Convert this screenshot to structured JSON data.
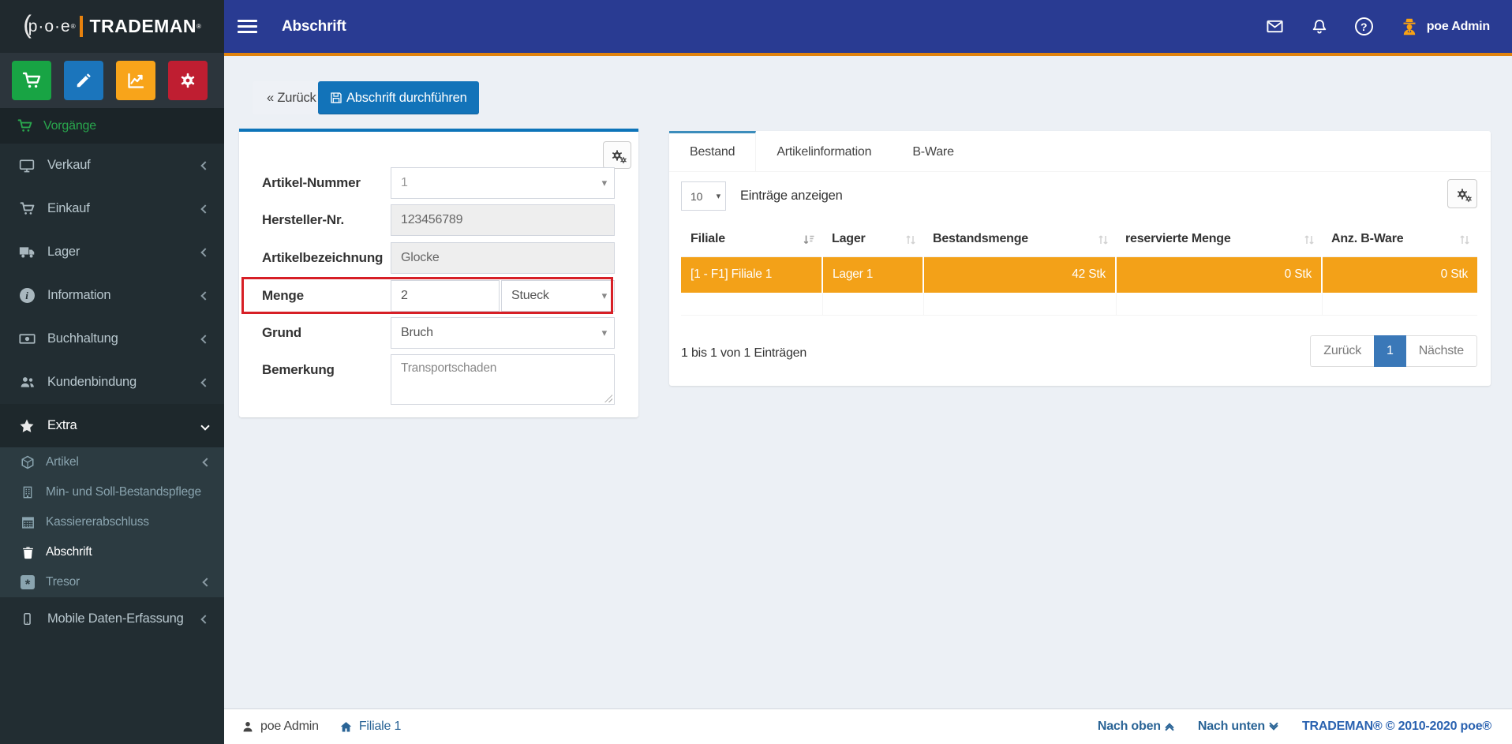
{
  "brand": {
    "arc": "(",
    "prefix": "p·o·e",
    "reg": "®",
    "name": "TRADEMAN"
  },
  "topbar": {
    "title": "Abschrift",
    "user": "poe Admin"
  },
  "sidebar": {
    "shortcuts": [
      {
        "icon": "cart-icon",
        "color": "#18a444"
      },
      {
        "icon": "pencil-icon",
        "color": "#1b75bc"
      },
      {
        "icon": "chart-icon",
        "color": "#f8a41a"
      },
      {
        "icon": "cogs-icon",
        "color": "#bf1e31"
      }
    ],
    "section_label": "Vorgänge",
    "items": [
      {
        "label": "Verkauf",
        "icon": "monitor-icon"
      },
      {
        "label": "Einkauf",
        "icon": "cart-icon"
      },
      {
        "label": "Lager",
        "icon": "truck-icon"
      },
      {
        "label": "Information",
        "icon": "info-circle-icon"
      },
      {
        "label": "Buchhaltung",
        "icon": "banknote-icon"
      },
      {
        "label": "Kundenbindung",
        "icon": "users-icon"
      },
      {
        "label": "Extra",
        "icon": "star-icon",
        "expanded": true
      }
    ],
    "extra_children": [
      {
        "label": "Artikel",
        "icon": "cube-icon"
      },
      {
        "label": "Min- und Soll-Bestandspflege",
        "icon": "building-icon"
      },
      {
        "label": "Kassiererabschluss",
        "icon": "calculator-icon"
      },
      {
        "label": "Abschrift",
        "icon": "trash-icon",
        "active": true
      },
      {
        "label": "Tresor",
        "icon": "safe-icon"
      }
    ],
    "bottom_item": {
      "label": "Mobile Daten-Erfassung",
      "icon": "mobile-icon"
    }
  },
  "toolbar": {
    "back": "« Zurück",
    "submit": "Abschrift durchführen"
  },
  "form": {
    "fields": [
      {
        "label": "Artikel-Nummer",
        "value": "1",
        "type": "select"
      },
      {
        "label": "Hersteller-Nr.",
        "value": "123456789",
        "type": "disabled"
      },
      {
        "label": "Artikelbezeichnung",
        "value": "Glocke",
        "type": "disabled"
      },
      {
        "label": "Menge",
        "value": "2",
        "unit": "Stueck",
        "highlighted": true
      },
      {
        "label": "Grund",
        "value": "Bruch",
        "type": "select"
      },
      {
        "label": "Bemerkung",
        "value": "Transportschaden",
        "type": "textarea"
      }
    ],
    "highlight_color": "#d71f26"
  },
  "tabs": {
    "active": "Bestand",
    "items": [
      "Bestand",
      "Artikelinformation",
      "B-Ware"
    ]
  },
  "table_card": {
    "page_size": "10",
    "page_size_label": "Einträge anzeigen",
    "columns": [
      "Filiale",
      "Lager",
      "Bestandsmenge",
      "reservierte Menge",
      "Anz. B-Ware"
    ],
    "rows": [
      {
        "cells": [
          "[1 - F1] Filiale 1",
          "Lager 1",
          "42 Stk",
          "0 Stk",
          "0 Stk"
        ],
        "highlight_color": "#f3a118"
      }
    ],
    "info": "1 bis 1 von 1 Einträgen",
    "pagination": {
      "prev": "Zurück",
      "page": "1",
      "next": "Nächste"
    }
  },
  "footer": {
    "user": "poe Admin",
    "filiale": "Filiale 1",
    "up": "Nach oben",
    "down": "Nach unten",
    "copyright": "TRADEMAN® © 2010-2020 poe®"
  },
  "colors": {
    "navbar": "#293b92",
    "navbar_accent": "#e0830e",
    "sidebar": "#222d32",
    "primary_button": "#1273b9",
    "panel_top_border": "#0d74b9",
    "tab_active_border": "#3c8dbc",
    "pagination_active": "#3a78b8"
  }
}
